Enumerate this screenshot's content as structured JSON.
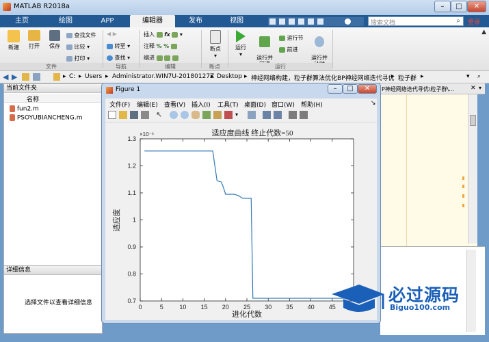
{
  "window": {
    "title": "MATLAB R2018a",
    "min": "–",
    "max": "□",
    "close": "✕"
  },
  "ribbon_tabs": [
    "主页",
    "绘图",
    "APP",
    "编辑器",
    "发布",
    "视图"
  ],
  "search": {
    "placeholder": "搜索文档"
  },
  "signin": "登录",
  "ribbon": {
    "new": "新建",
    "open": "打开",
    "save": "保存",
    "find_files": "查找文件",
    "compare": "比较",
    "print": "打印",
    "goto": "转至",
    "find": "查找",
    "insert": "插入",
    "comment": "注释",
    "indent": "缩进",
    "breakpoints": "断点",
    "run": "运行",
    "run_advance": "运行并\n前进",
    "run_section": "运行节",
    "advance": "前进",
    "run_time": "运行并\n计时",
    "groups": {
      "file": "文件",
      "navigate": "导航",
      "edit": "编辑",
      "breakpoints": "断点",
      "run": "运行"
    }
  },
  "path": [
    "C:",
    "Users",
    "Administrator.WIN7U-20180127Z",
    "Desktop",
    "神经网络构建，粒子群算法优化BP神经网络迭代寻优",
    "粒子群"
  ],
  "path_right": "P神经网络迭代寻优\\粒子群\\...",
  "current_folder": {
    "title": "当前文件夹",
    "col_name": "名称",
    "files": [
      "fun2.m",
      "PSOYUBIANCHENG.m"
    ]
  },
  "details": {
    "title": "详细信息",
    "hint": "选择文件以查看详细信息"
  },
  "figure": {
    "title": "Figure 1",
    "menu": [
      "文件(F)",
      "编辑(E)",
      "查看(V)",
      "插入(I)",
      "工具(T)",
      "桌面(D)",
      "窗口(W)",
      "帮助(H)"
    ]
  },
  "chart_data": {
    "type": "line",
    "title": "适应度曲线  终止代数=50",
    "xlabel": "进化代数",
    "ylabel": "适应度",
    "exponent": "×10⁻⁵",
    "xlim": [
      0,
      50
    ],
    "ylim": [
      0.7,
      1.3
    ],
    "xticks": [
      0,
      5,
      10,
      15,
      20,
      25,
      30,
      35,
      40,
      45
    ],
    "yticks": [
      0.7,
      0.8,
      0.9,
      1.0,
      1.1,
      1.2,
      1.3
    ],
    "ytick_labels": [
      "0.7",
      "0.8",
      "0.9",
      "1",
      "1.1",
      "1.2",
      "1.3"
    ],
    "line_color": "#3277b5",
    "x": [
      1,
      17,
      18,
      19,
      19.5,
      20,
      21,
      22,
      23,
      24,
      25,
      26,
      26.4,
      27,
      50
    ],
    "y": [
      1.255,
      1.255,
      1.145,
      1.14,
      1.12,
      1.095,
      1.095,
      1.095,
      1.09,
      1.08,
      1.08,
      1.08,
      0.71,
      0.71,
      0.71
    ]
  },
  "watermark": {
    "text": "必过源码",
    "sub": "Biguo100.com"
  }
}
